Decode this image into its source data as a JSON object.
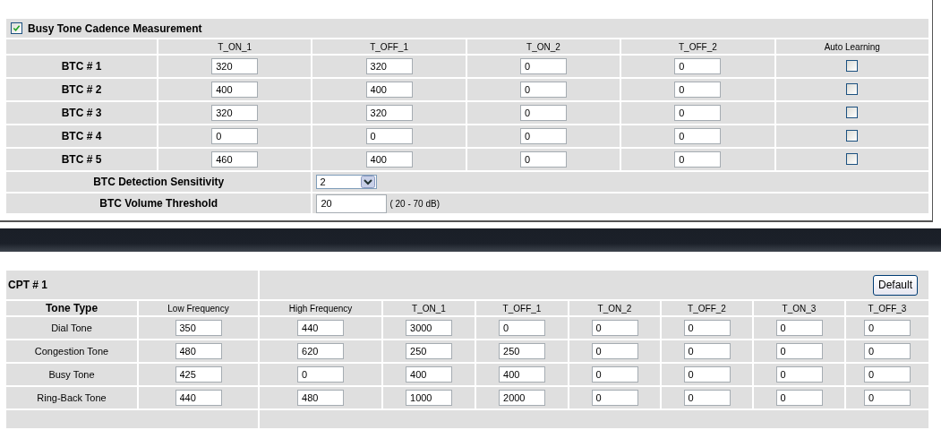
{
  "btc": {
    "enabled": true,
    "title": "Busy Tone Cadence Measurement",
    "columns": [
      "T_ON_1",
      "T_OFF_1",
      "T_ON_2",
      "T_OFF_2",
      "Auto Learning"
    ],
    "rows": [
      {
        "label": "BTC # 1",
        "values": [
          "320",
          "320",
          "0",
          "0"
        ],
        "auto_learning": false
      },
      {
        "label": "BTC # 2",
        "values": [
          "400",
          "400",
          "0",
          "0"
        ],
        "auto_learning": false
      },
      {
        "label": "BTC # 3",
        "values": [
          "320",
          "320",
          "0",
          "0"
        ],
        "auto_learning": false
      },
      {
        "label": "BTC # 4",
        "values": [
          "0",
          "0",
          "0",
          "0"
        ],
        "auto_learning": false
      },
      {
        "label": "BTC # 5",
        "values": [
          "460",
          "400",
          "0",
          "0"
        ],
        "auto_learning": false
      }
    ],
    "sensitivity": {
      "label": "BTC Detection Sensitivity",
      "value": "2"
    },
    "threshold": {
      "label": "BTC Volume Threshold",
      "value": "20",
      "range": "( 20 - 70 dB)"
    }
  },
  "cpt": {
    "title": "CPT # 1",
    "default_button": "Default",
    "columns": [
      "Tone Type",
      "Low Frequency",
      "High Frequency",
      "T_ON_1",
      "T_OFF_1",
      "T_ON_2",
      "T_OFF_2",
      "T_ON_3",
      "T_OFF_3"
    ],
    "rows": [
      {
        "label": "Dial Tone",
        "values": [
          "350",
          "440",
          "3000",
          "0",
          "0",
          "0",
          "0",
          "0"
        ]
      },
      {
        "label": "Congestion Tone",
        "values": [
          "480",
          "620",
          "250",
          "250",
          "0",
          "0",
          "0",
          "0"
        ]
      },
      {
        "label": "Busy Tone",
        "values": [
          "425",
          "0",
          "400",
          "400",
          "0",
          "0",
          "0",
          "0"
        ]
      },
      {
        "label": "Ring-Back Tone",
        "values": [
          "440",
          "480",
          "1000",
          "2000",
          "0",
          "0",
          "0",
          "0"
        ]
      }
    ]
  }
}
